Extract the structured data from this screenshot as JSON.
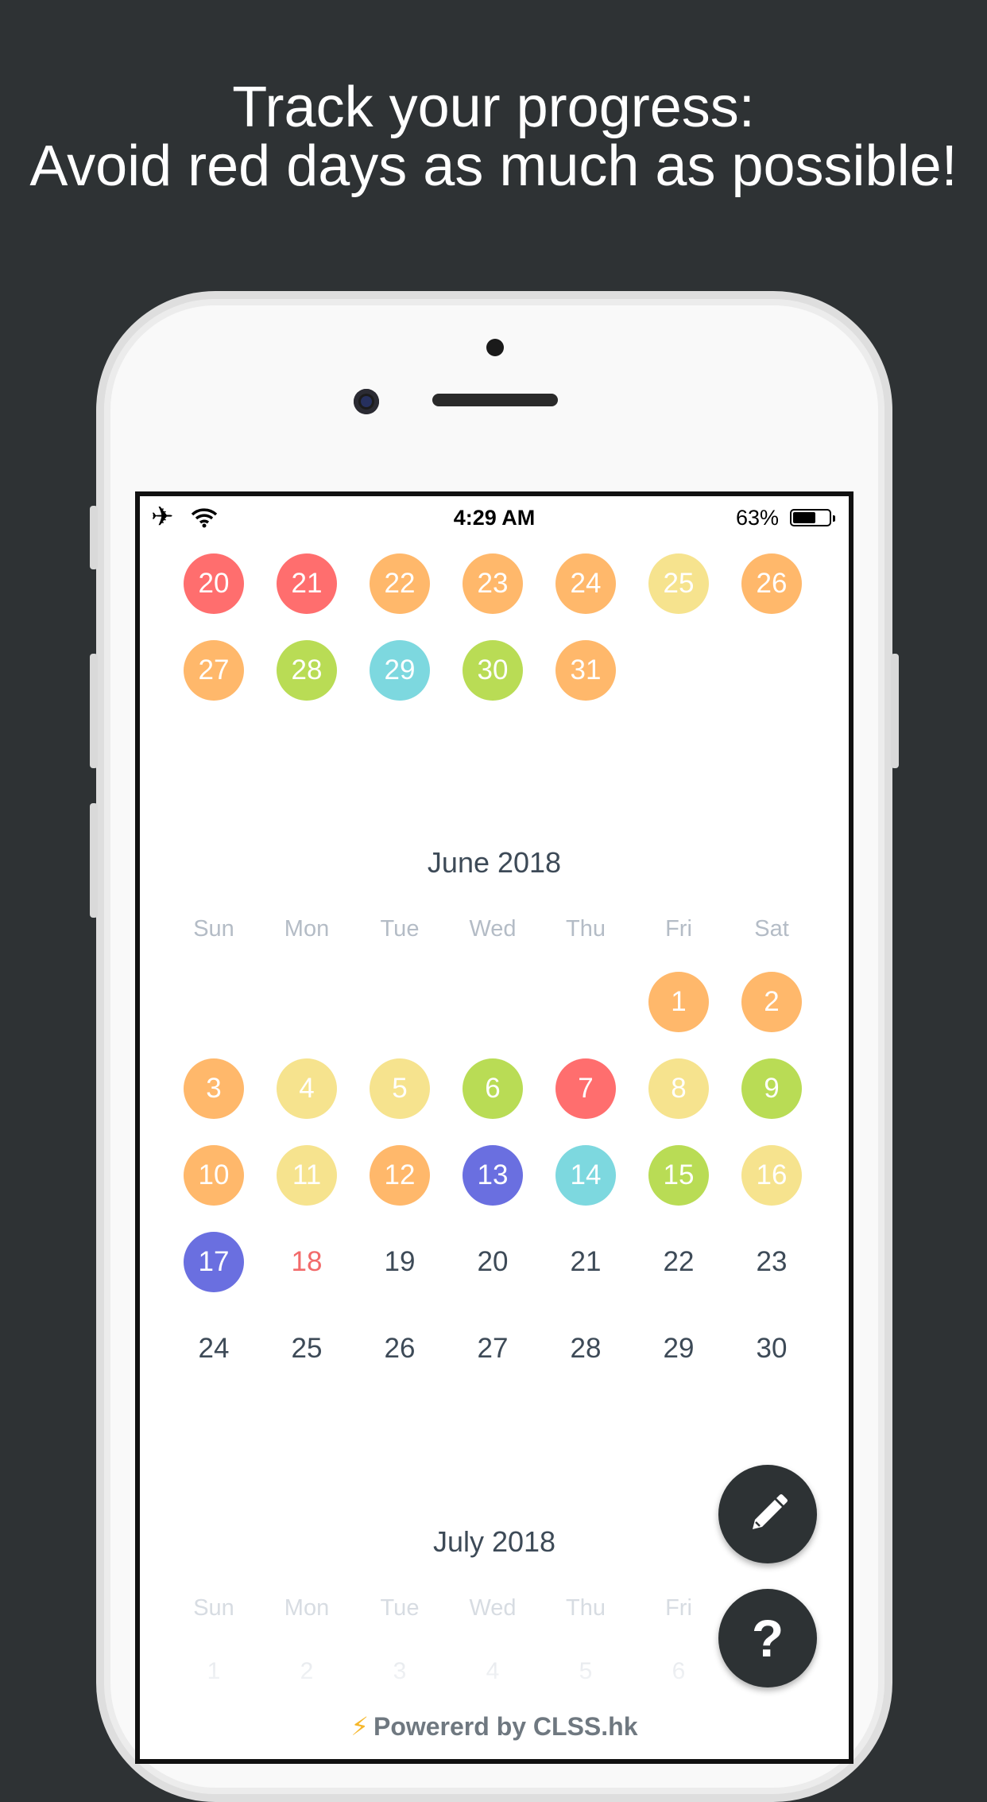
{
  "headline": {
    "line1": "Track your progress:",
    "line2": "Avoid red days as much as possible!"
  },
  "status_bar": {
    "time": "4:29 AM",
    "battery_text": "63%",
    "battery_level": 0.63,
    "airplane_icon": "airplane-icon",
    "wifi_icon": "wifi-icon"
  },
  "colors": {
    "red": "#ff6e6e",
    "orange": "#ffb86b",
    "yellow": "#f6e38e",
    "green": "#b9dc55",
    "teal": "#7dd8df",
    "purple": "#6a6fe0"
  },
  "may_tail": [
    [
      "20",
      "red"
    ],
    [
      "21",
      "red"
    ],
    [
      "22",
      "orange"
    ],
    [
      "23",
      "orange"
    ],
    [
      "24",
      "orange"
    ],
    [
      "25",
      "yellow"
    ],
    [
      "26",
      "orange"
    ],
    [
      "27",
      "orange"
    ],
    [
      "28",
      "green"
    ],
    [
      "29",
      "teal"
    ],
    [
      "30",
      "green"
    ],
    [
      "31",
      "orange"
    ]
  ],
  "june": {
    "title": "June 2018",
    "weekdays": [
      "Sun",
      "Mon",
      "Tue",
      "Wed",
      "Thu",
      "Fri",
      "Sat"
    ],
    "marked_days": [
      [
        "1",
        "orange"
      ],
      [
        "2",
        "orange"
      ],
      [
        "3",
        "orange"
      ],
      [
        "4",
        "yellow"
      ],
      [
        "5",
        "yellow"
      ],
      [
        "6",
        "green"
      ],
      [
        "7",
        "red"
      ],
      [
        "8",
        "yellow"
      ],
      [
        "9",
        "green"
      ],
      [
        "10",
        "orange"
      ],
      [
        "11",
        "yellow"
      ],
      [
        "12",
        "orange"
      ],
      [
        "13",
        "purple"
      ],
      [
        "14",
        "teal"
      ],
      [
        "15",
        "green"
      ],
      [
        "16",
        "yellow"
      ],
      [
        "17",
        "purple"
      ]
    ],
    "today": "18",
    "plain_days": [
      "19",
      "20",
      "21",
      "22",
      "23",
      "24",
      "25",
      "26",
      "27",
      "28",
      "29",
      "30"
    ]
  },
  "july": {
    "title": "July 2018",
    "weekdays": [
      "Sun",
      "Mon",
      "Tue",
      "Wed",
      "Thu",
      "Fri"
    ],
    "first_row": [
      "1",
      "2",
      "3",
      "4",
      "5",
      "6"
    ]
  },
  "fab": {
    "edit_icon": "pencil-icon",
    "help_label": "?"
  },
  "footer": {
    "text": "Powererd by CLSS.hk",
    "icon": "lightning-icon"
  }
}
